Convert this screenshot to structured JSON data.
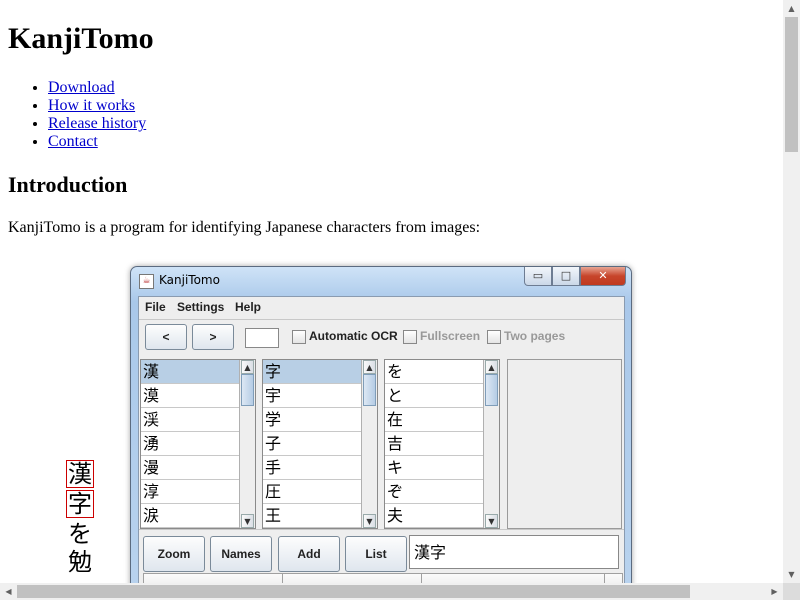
{
  "page": {
    "title": "KanjiTomo",
    "nav": [
      "Download",
      "How it works",
      "Release history",
      "Contact"
    ],
    "section_heading": "Introduction",
    "intro_text": "KanjiTomo is a program for identifying Japanese characters from images:"
  },
  "vertical_text": {
    "boxed": [
      "漢",
      "字"
    ],
    "plain": [
      "を",
      "勉"
    ]
  },
  "window": {
    "title": "KanjiTomo",
    "controls": {
      "minimize": "▭",
      "maximize": "□",
      "close": "✕"
    },
    "menu": [
      "File",
      "Settings",
      "Help"
    ],
    "toolbar": {
      "prev": "<",
      "next": ">",
      "automatic_ocr": "Automatic OCR",
      "fullscreen": "Fullscreen",
      "two_pages": "Two pages"
    },
    "lists": [
      [
        "漢",
        "漠",
        "渓",
        "湧",
        "漫",
        "淳",
        "涙"
      ],
      [
        "字",
        "宇",
        "学",
        "子",
        "手",
        "圧",
        "王"
      ],
      [
        "を",
        "と",
        "在",
        "吉",
        "キ",
        "ぞ",
        "夫"
      ]
    ],
    "buttons": {
      "zoom": "Zoom",
      "names": "Names",
      "add": "Add",
      "list": "List"
    },
    "result": "漢字"
  },
  "scroll": {
    "up": "▲",
    "down": "▼",
    "left": "◀",
    "right": "▶"
  }
}
